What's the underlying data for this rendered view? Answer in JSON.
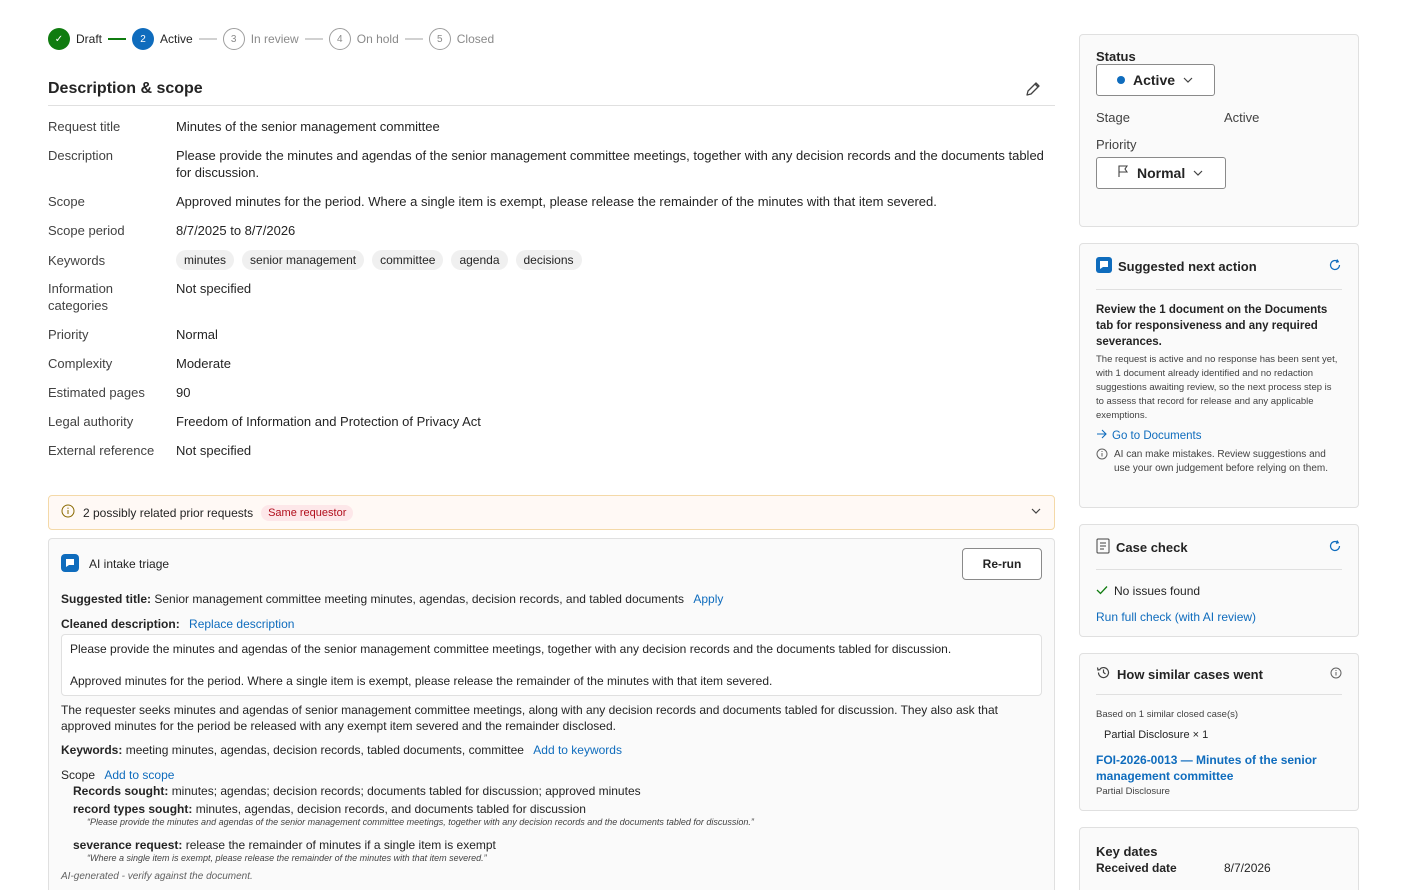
{
  "stepper": [
    {
      "num": "✓",
      "label": "Draft",
      "state": "done"
    },
    {
      "num": "2",
      "label": "Active",
      "state": "active"
    },
    {
      "num": "3",
      "label": "In review",
      "state": "todo"
    },
    {
      "num": "4",
      "label": "On hold",
      "state": "todo"
    },
    {
      "num": "5",
      "label": "Closed",
      "state": "todo"
    }
  ],
  "section": {
    "title": "Description & scope",
    "edit_icon": "pencil-icon"
  },
  "fields": {
    "request_title": {
      "k": "Request title",
      "v": "Minutes of the senior management committee"
    },
    "description": {
      "k": "Description",
      "v": "Please provide the minutes and agendas of the senior management committee meetings, together with any decision records and the documents tabled for discussion."
    },
    "scope": {
      "k": "Scope",
      "v": "Approved minutes for the period. Where a single item is exempt, please release the remainder of the minutes with that item severed."
    },
    "scope_period": {
      "k": "Scope period",
      "v": "8/7/2025 to 8/7/2026"
    },
    "keywords": {
      "k": "Keywords",
      "chips": [
        "minutes",
        "senior management",
        "committee",
        "agenda",
        "decisions"
      ]
    },
    "info_categories": {
      "k": "Information categories",
      "v": "Not specified"
    },
    "priority": {
      "k": "Priority",
      "v": "Normal"
    },
    "complexity": {
      "k": "Complexity",
      "v": "Moderate"
    },
    "estimated_pages": {
      "k": "Estimated pages",
      "v": "90"
    },
    "legal_authority": {
      "k": "Legal authority",
      "v": "Freedom of Information and Protection of Privacy Act"
    },
    "external_reference": {
      "k": "External reference",
      "v": "Not specified"
    }
  },
  "related": {
    "text": "2 possibly related prior requests",
    "badge": "Same requestor"
  },
  "triage": {
    "title": "AI intake triage",
    "rerun": "Re-run",
    "suggested_title_label": "Suggested title:",
    "suggested_title": "Senior management committee meeting minutes, agendas, decision records, and tabled documents",
    "apply": "Apply",
    "cleaned_label": "Cleaned description:",
    "replace": "Replace description",
    "quote1": "Please provide the minutes and agendas of the senior management committee meetings, together with any decision records and the documents tabled for discussion.",
    "quote2": "Approved minutes for the period. Where a single item is exempt, please release the remainder of the minutes with that item severed.",
    "summary": "The requester seeks minutes and agendas of senior management committee meetings, along with any decision records and documents tabled for discussion. They also ask that approved minutes for the period be released with any exempt item severed and the remainder disclosed.",
    "keywords_label": "Keywords:",
    "keywords": "meeting minutes, agendas, decision records, tabled documents, committee",
    "add_keywords": "Add to keywords",
    "scope_label": "Scope",
    "add_scope": "Add to scope",
    "records_label": "Records sought:",
    "records": "minutes; agendas; decision records; documents tabled for discussion; approved minutes",
    "types_label": "record types sought:",
    "types": "minutes, agendas, decision records, and documents tabled for discussion",
    "types_quote": "“Please provide the minutes and agendas of the senior management committee meetings, together with any decision records and the documents tabled for discussion.”",
    "sever_label": "severance request:",
    "sever": "release the remainder of minutes if a single item is exempt",
    "sever_quote": "“Where a single item is exempt, please release the remainder of the minutes with that item severed.”",
    "note": "AI-generated - verify against the document."
  },
  "status_card": {
    "status_label": "Status",
    "status_value": "Active",
    "stage_label": "Stage",
    "stage_value": "Active",
    "priority_label": "Priority",
    "priority_value": "Normal"
  },
  "next_action": {
    "title": "Suggested next action",
    "headline": "Review the 1 document on the Documents tab for responsiveness and any required severances.",
    "body": "The request is active and no response has been sent yet, with 1 document already identified and no redaction suggestions awaiting review, so the next process step is to assess that record for release and any applicable exemptions.",
    "link": "Go to Documents",
    "disclaimer": "AI can make mistakes. Review suggestions and use your own judgement before relying on them."
  },
  "case_check": {
    "title": "Case check",
    "result": "No issues found",
    "link": "Run full check (with AI review)"
  },
  "similar": {
    "title": "How similar cases went",
    "based_on": "Based on 1 similar closed case(s)",
    "chip": "Partial Disclosure × 1",
    "case_link": "FOI-2026-0013 — Minutes of the senior management committee",
    "case_outcome": "Partial Disclosure"
  },
  "key_dates": {
    "title": "Key dates",
    "received_label": "Received date",
    "received_value": "8/7/2026"
  },
  "colors": {
    "accent": "#0f6cbd",
    "success": "#107c10",
    "warning_bg": "#fff9f5",
    "badge_red": "#b10e1c"
  }
}
